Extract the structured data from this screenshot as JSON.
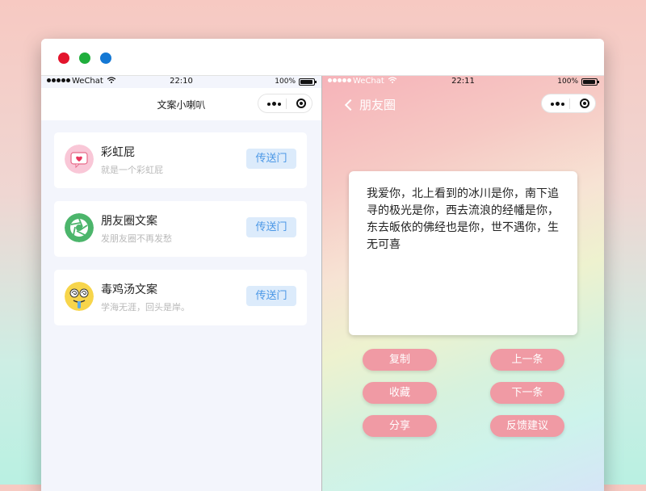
{
  "colors": {
    "accent_blue": "#4a97e6",
    "button_pink": "#f09aa4",
    "transfer_bg": "#dcebfb"
  },
  "left_phone": {
    "status": {
      "carrier": "WeChat",
      "time": "22:10",
      "battery": "100%"
    },
    "title": "文案小喇叭",
    "items": [
      {
        "icon": "rainbow-heart-icon",
        "name": "彩虹屁",
        "desc": "就是一个彩虹屁",
        "action": "传送门"
      },
      {
        "icon": "camera-aperture-icon",
        "name": "朋友圈文案",
        "desc": "发朋友圈不再发愁",
        "action": "传送门"
      },
      {
        "icon": "dizzy-face-icon",
        "name": "毒鸡汤文案",
        "desc": "学海无涯，回头是岸。",
        "action": "传送门"
      }
    ]
  },
  "right_phone": {
    "status": {
      "carrier": "WeChat",
      "time": "22:11",
      "battery": "100%"
    },
    "back_label": "朋友圈",
    "quote": "我爱你，北上看到的冰川是你，南下追寻的极光是你，西去流浪的经幡是你，东去皈依的佛经也是你，世不遇你，生无可喜",
    "buttons": {
      "copy": "复制",
      "prev": "上一条",
      "favorite": "收藏",
      "next": "下一条",
      "share": "分享",
      "feedback": "反馈建议"
    }
  }
}
